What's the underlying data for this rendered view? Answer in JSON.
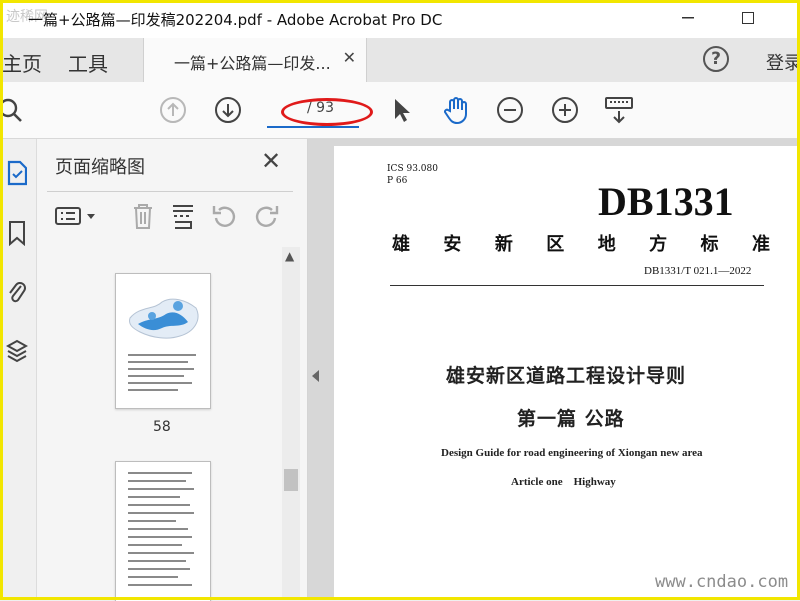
{
  "window": {
    "title": "一篇+公路篇—印发稿202204.pdf - Adobe Acrobat Pro DC",
    "watermark_top": "迹稀网"
  },
  "tabs": {
    "home": "主页",
    "tools": "工具",
    "document": "一篇+公路篇—印发...",
    "login": "登录"
  },
  "toolbar": {
    "page_input": "",
    "page_total": "/ 93"
  },
  "panel": {
    "title": "页面缩略图",
    "thumbnails": [
      {
        "page": "58"
      },
      {
        "page": ""
      }
    ]
  },
  "document": {
    "ics": "ICS 93.080",
    "p": "P 66",
    "db_code": "DB1331",
    "standard_chars": [
      "雄",
      "安",
      "新",
      "区",
      "地",
      "方",
      "标",
      "准"
    ],
    "number": "DB1331/T 021.1—2022",
    "title_cn": "雄安新区道路工程设计导则",
    "subtitle_cn": "第一篇  公路",
    "title_en": "Design Guide for road engineering of Xiongan new area",
    "subtitle_en": "Article one    Highway"
  },
  "watermark": "www.cndao.com",
  "colors": {
    "accent": "#1b6ac9",
    "annotation": "#e01a1a",
    "frame": "#f2e600"
  }
}
